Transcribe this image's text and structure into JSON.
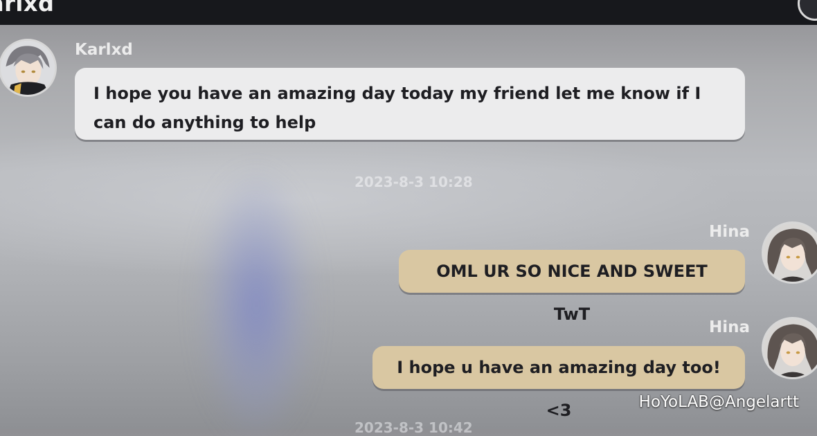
{
  "header": {
    "title": "arlxd"
  },
  "messages": [
    {
      "sender": "Karlxd",
      "text": "I hope you have an amazing day today my friend let me know if I can do anything to help",
      "direction": "in"
    },
    {
      "sender": "Hina",
      "text": "OML UR SO NICE AND SWEET TwT",
      "direction": "out"
    },
    {
      "sender": "Hina",
      "text": "I hope u have an amazing day too! <3",
      "direction": "out"
    }
  ],
  "timestamps": [
    "2023-8-3 10:28",
    "2023-8-3 10:42"
  ],
  "watermark": "HoYoLAB@Angelartt",
  "colors": {
    "incoming_bubble": "#ececed",
    "outgoing_bubble": "#d9c7a2",
    "topbar": "#17181c"
  }
}
